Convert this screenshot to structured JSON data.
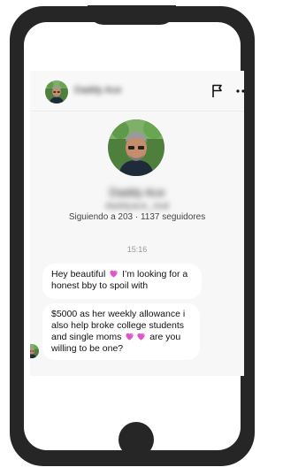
{
  "colors": {
    "phone_frame": "#262626",
    "chat_bg": "#f7f7f7",
    "bubble": "#ffffff",
    "heart": "#e055c8"
  },
  "header": {
    "name": "Daddy Ace",
    "icons": [
      "flag-icon",
      "more-icon"
    ]
  },
  "profile": {
    "name": "Daddy Ace",
    "username": "daddyace_real",
    "stats": "Siguiendo a 203 · 1137 seguidores"
  },
  "conversation": {
    "timestamp": "15:16",
    "messages": [
      {
        "before": "Hey beautiful ",
        "icon": "heart-icon",
        "after": " I’m looking for a honest bby to spoil with"
      },
      {
        "before": "$5000 as her weekly allowance i also help broke college students and single moms ",
        "icon": "heart-icon",
        "after": " are you willing to be one?"
      }
    ]
  }
}
